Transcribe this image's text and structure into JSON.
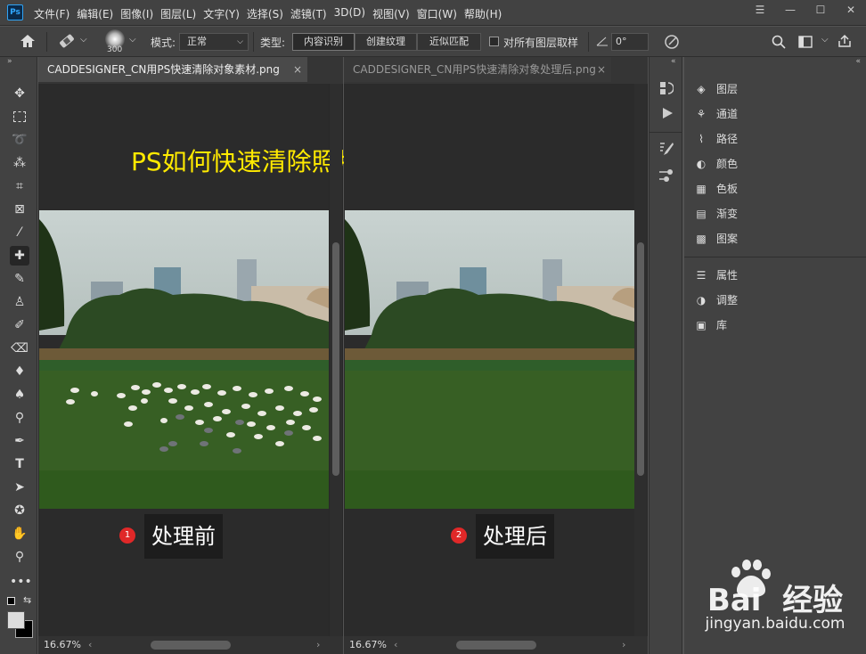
{
  "app": {
    "logo": "Ps",
    "menus": [
      "文件(F)",
      "编辑(E)",
      "图像(I)",
      "图层(L)",
      "文字(Y)",
      "选择(S)",
      "滤镜(T)",
      "3D(D)",
      "视图(V)",
      "窗口(W)",
      "帮助(H)"
    ],
    "window_controls": [
      "☰",
      "—",
      "☐",
      "✕"
    ]
  },
  "options": {
    "brush_size": "300",
    "mode_label": "模式:",
    "mode_value": "正常",
    "type_label": "类型:",
    "type_buttons": [
      "内容识别",
      "创建纹理",
      "近似匹配"
    ],
    "sample_all_label": "对所有图层取样",
    "angle_value": "0°"
  },
  "docs": [
    {
      "tab": "CADDESIGNER_CN用PS快速清除对象素材.png",
      "close": "×",
      "label": "处理前",
      "badge": "1",
      "zoom": "16.67%"
    },
    {
      "tab": "CADDESIGNER_CN用PS快速清除对象处理后.png",
      "close": "×",
      "label": "处理后",
      "badge": "2",
      "zoom": "16.67%"
    }
  ],
  "overlay_title": "PS如何快速清除照片上多而杂乱的对象",
  "panels": [
    "图层",
    "通道",
    "路径",
    "颜色",
    "色板",
    "渐变",
    "图案",
    "属性",
    "调整",
    "库"
  ],
  "watermark": {
    "brand": "Bai  经验",
    "url": "jingyan.baidu.com"
  },
  "colors": {
    "accent": "#31a8ff",
    "title_yellow": "#ffea00",
    "badge_red": "#e02828"
  }
}
